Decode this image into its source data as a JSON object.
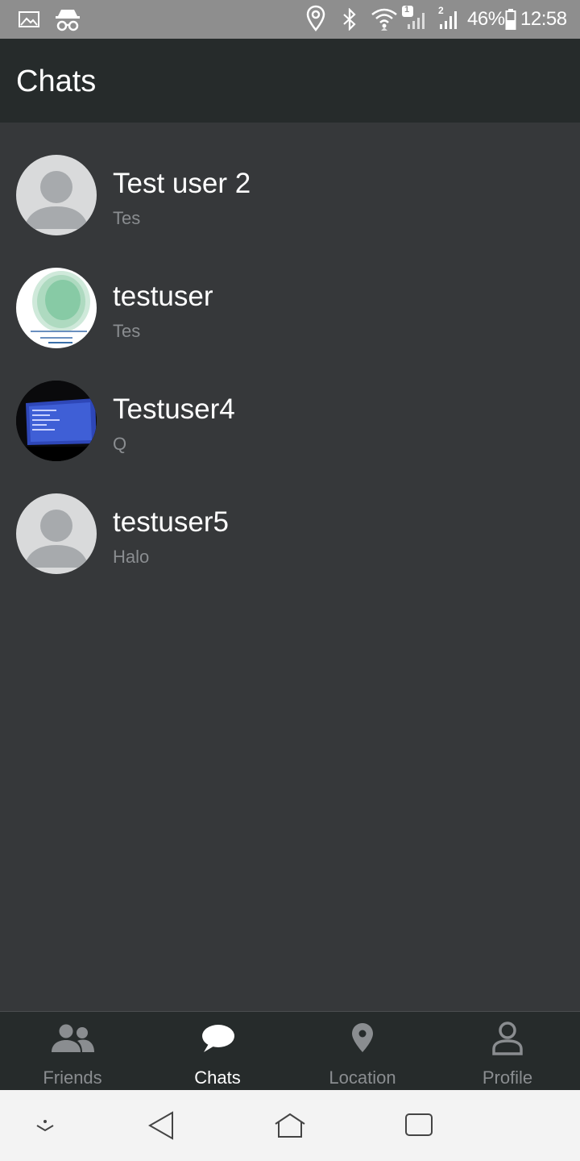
{
  "status_bar": {
    "battery": "46%",
    "time": "12:58",
    "sim1_badge": "1",
    "sim2_badge": "2",
    "icons": [
      "image-icon",
      "incognito-icon",
      "location-icon",
      "bluetooth-icon",
      "wifi-icon",
      "signal-icon",
      "battery-icon"
    ]
  },
  "header": {
    "title": "Chats"
  },
  "chats": [
    {
      "name": "Test user 2",
      "preview": "Tes",
      "avatar": "default-person"
    },
    {
      "name": "testuser",
      "preview": "Tes",
      "avatar": "photo-green-pattern"
    },
    {
      "name": "Testuser4",
      "preview": "Q",
      "avatar": "photo-monitor"
    },
    {
      "name": "testuser5",
      "preview": "Halo",
      "avatar": "default-person"
    }
  ],
  "bottom_nav": {
    "items": [
      {
        "label": "Friends",
        "icon": "friends-icon",
        "active": false
      },
      {
        "label": "Chats",
        "icon": "chat-bubble-icon",
        "active": true
      },
      {
        "label": "Location",
        "icon": "map-pin-icon",
        "active": false
      },
      {
        "label": "Profile",
        "icon": "profile-icon",
        "active": false
      }
    ]
  },
  "colors": {
    "status_bar": "#8e8e8e",
    "app_bar": "#262b2b",
    "background": "#36383a",
    "text_primary": "#ffffff",
    "text_secondary": "#8a8d90",
    "system_nav": "#f3f3f3"
  }
}
